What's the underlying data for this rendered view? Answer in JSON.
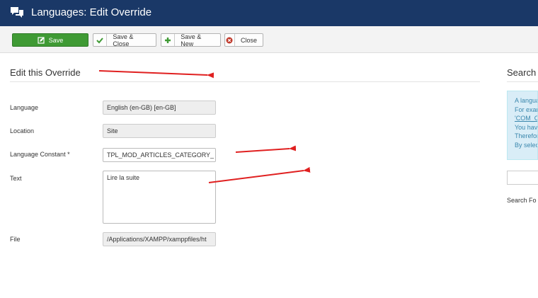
{
  "header": {
    "title": "Languages: Edit Override"
  },
  "toolbar": {
    "save_label": "Save",
    "save_close_label": "Save & Close",
    "save_new_label": "Save & New",
    "close_label": "Close"
  },
  "form": {
    "heading": "Edit this Override",
    "language_label": "Language",
    "language_value": "English (en-GB) [en-GB]",
    "location_label": "Location",
    "location_value": "Site",
    "constant_label": "Language Constant *",
    "constant_value": "TPL_MOD_ARTICLES_CATEGORY_",
    "text_label": "Text",
    "text_value": "Lire la suite",
    "file_label": "File",
    "file_value": "/Applications/XAMPP/xamppfiles/ht"
  },
  "search_panel": {
    "heading": "Search",
    "info_lines": [
      "A langua",
      "For exar",
      "'COM_C",
      "You hav",
      "Therefor",
      "By selec"
    ],
    "search_for_label": "Search Fo"
  },
  "colors": {
    "header_bg": "#1a3867",
    "save_green": "#3f9a34",
    "annotation_red": "#e02020",
    "info_bg": "#d9edf7",
    "info_text": "#3a87ad"
  }
}
